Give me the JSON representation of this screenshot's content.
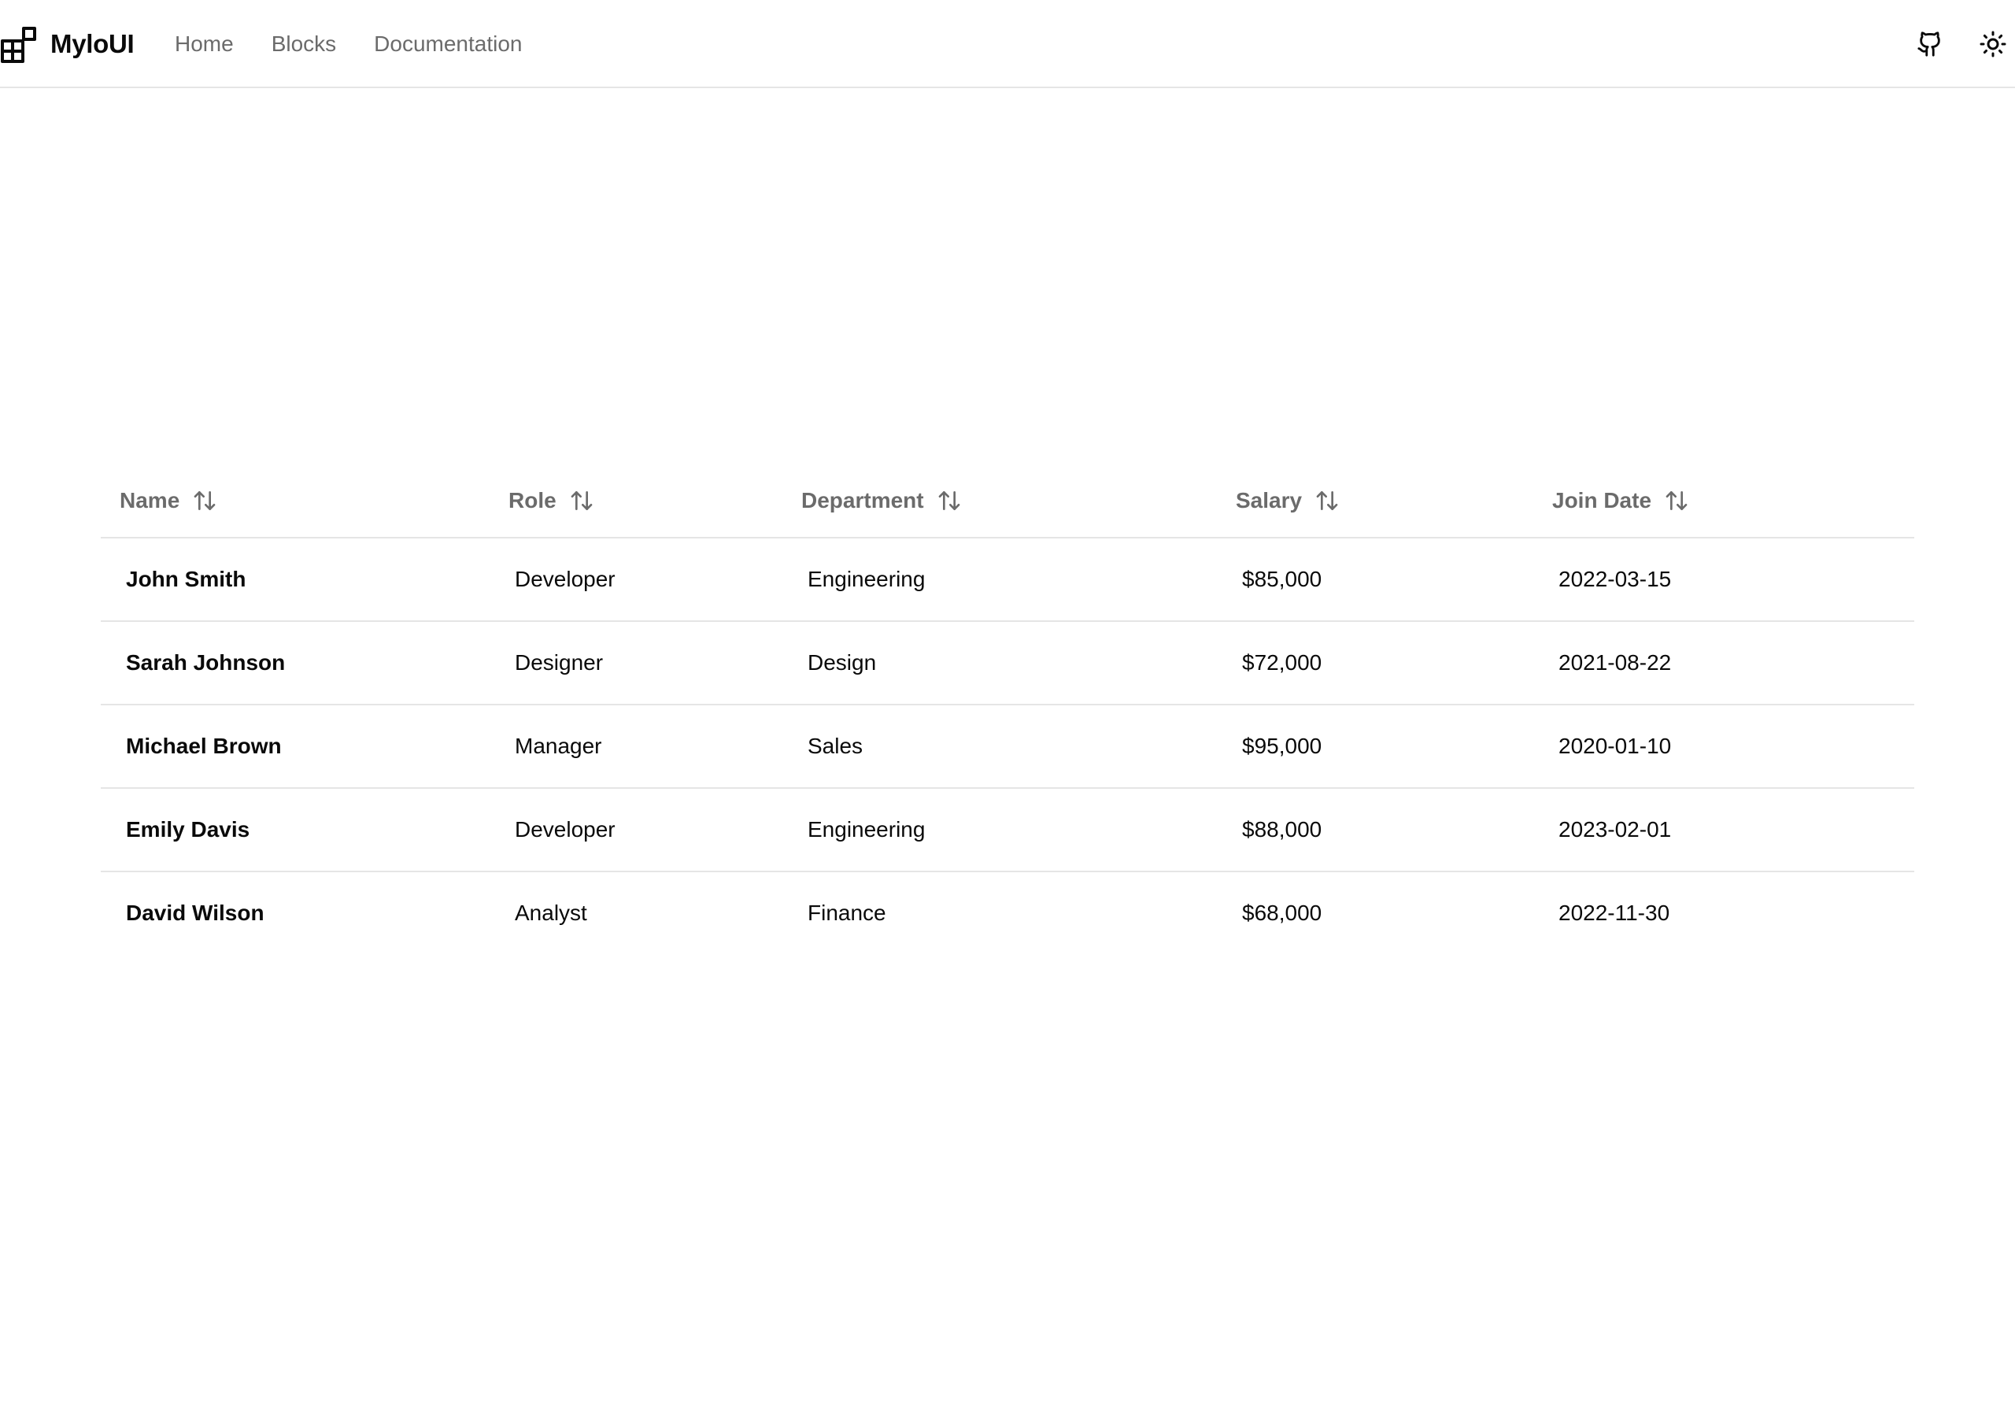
{
  "header": {
    "brand": "MyloUI",
    "brand_icon": "blocks-logo-icon",
    "nav": [
      "Home",
      "Blocks",
      "Documentation"
    ],
    "actions": [
      {
        "icon": "github-icon"
      },
      {
        "icon": "sun-icon"
      }
    ]
  },
  "table": {
    "columns": [
      {
        "label": "Name",
        "sort_icon": "sort-arrows-icon"
      },
      {
        "label": "Role",
        "sort_icon": "sort-arrows-icon"
      },
      {
        "label": "Department",
        "sort_icon": "sort-arrows-icon"
      },
      {
        "label": "Salary",
        "sort_icon": "sort-arrows-icon"
      },
      {
        "label": "Join Date",
        "sort_icon": "sort-arrows-icon"
      }
    ],
    "rows": [
      {
        "name": "John Smith",
        "role": "Developer",
        "department": "Engineering",
        "salary": "$85,000",
        "join_date": "2022-03-15"
      },
      {
        "name": "Sarah Johnson",
        "role": "Designer",
        "department": "Design",
        "salary": "$72,000",
        "join_date": "2021-08-22"
      },
      {
        "name": "Michael Brown",
        "role": "Manager",
        "department": "Sales",
        "salary": "$95,000",
        "join_date": "2020-01-10"
      },
      {
        "name": "Emily Davis",
        "role": "Developer",
        "department": "Engineering",
        "salary": "$88,000",
        "join_date": "2023-02-01"
      },
      {
        "name": "David Wilson",
        "role": "Analyst",
        "department": "Finance",
        "salary": "$68,000",
        "join_date": "2022-11-30"
      }
    ]
  },
  "colors": {
    "text": "#0a0a0a",
    "muted": "#6b6b6b",
    "border": "#e5e5e5",
    "background": "#ffffff"
  }
}
